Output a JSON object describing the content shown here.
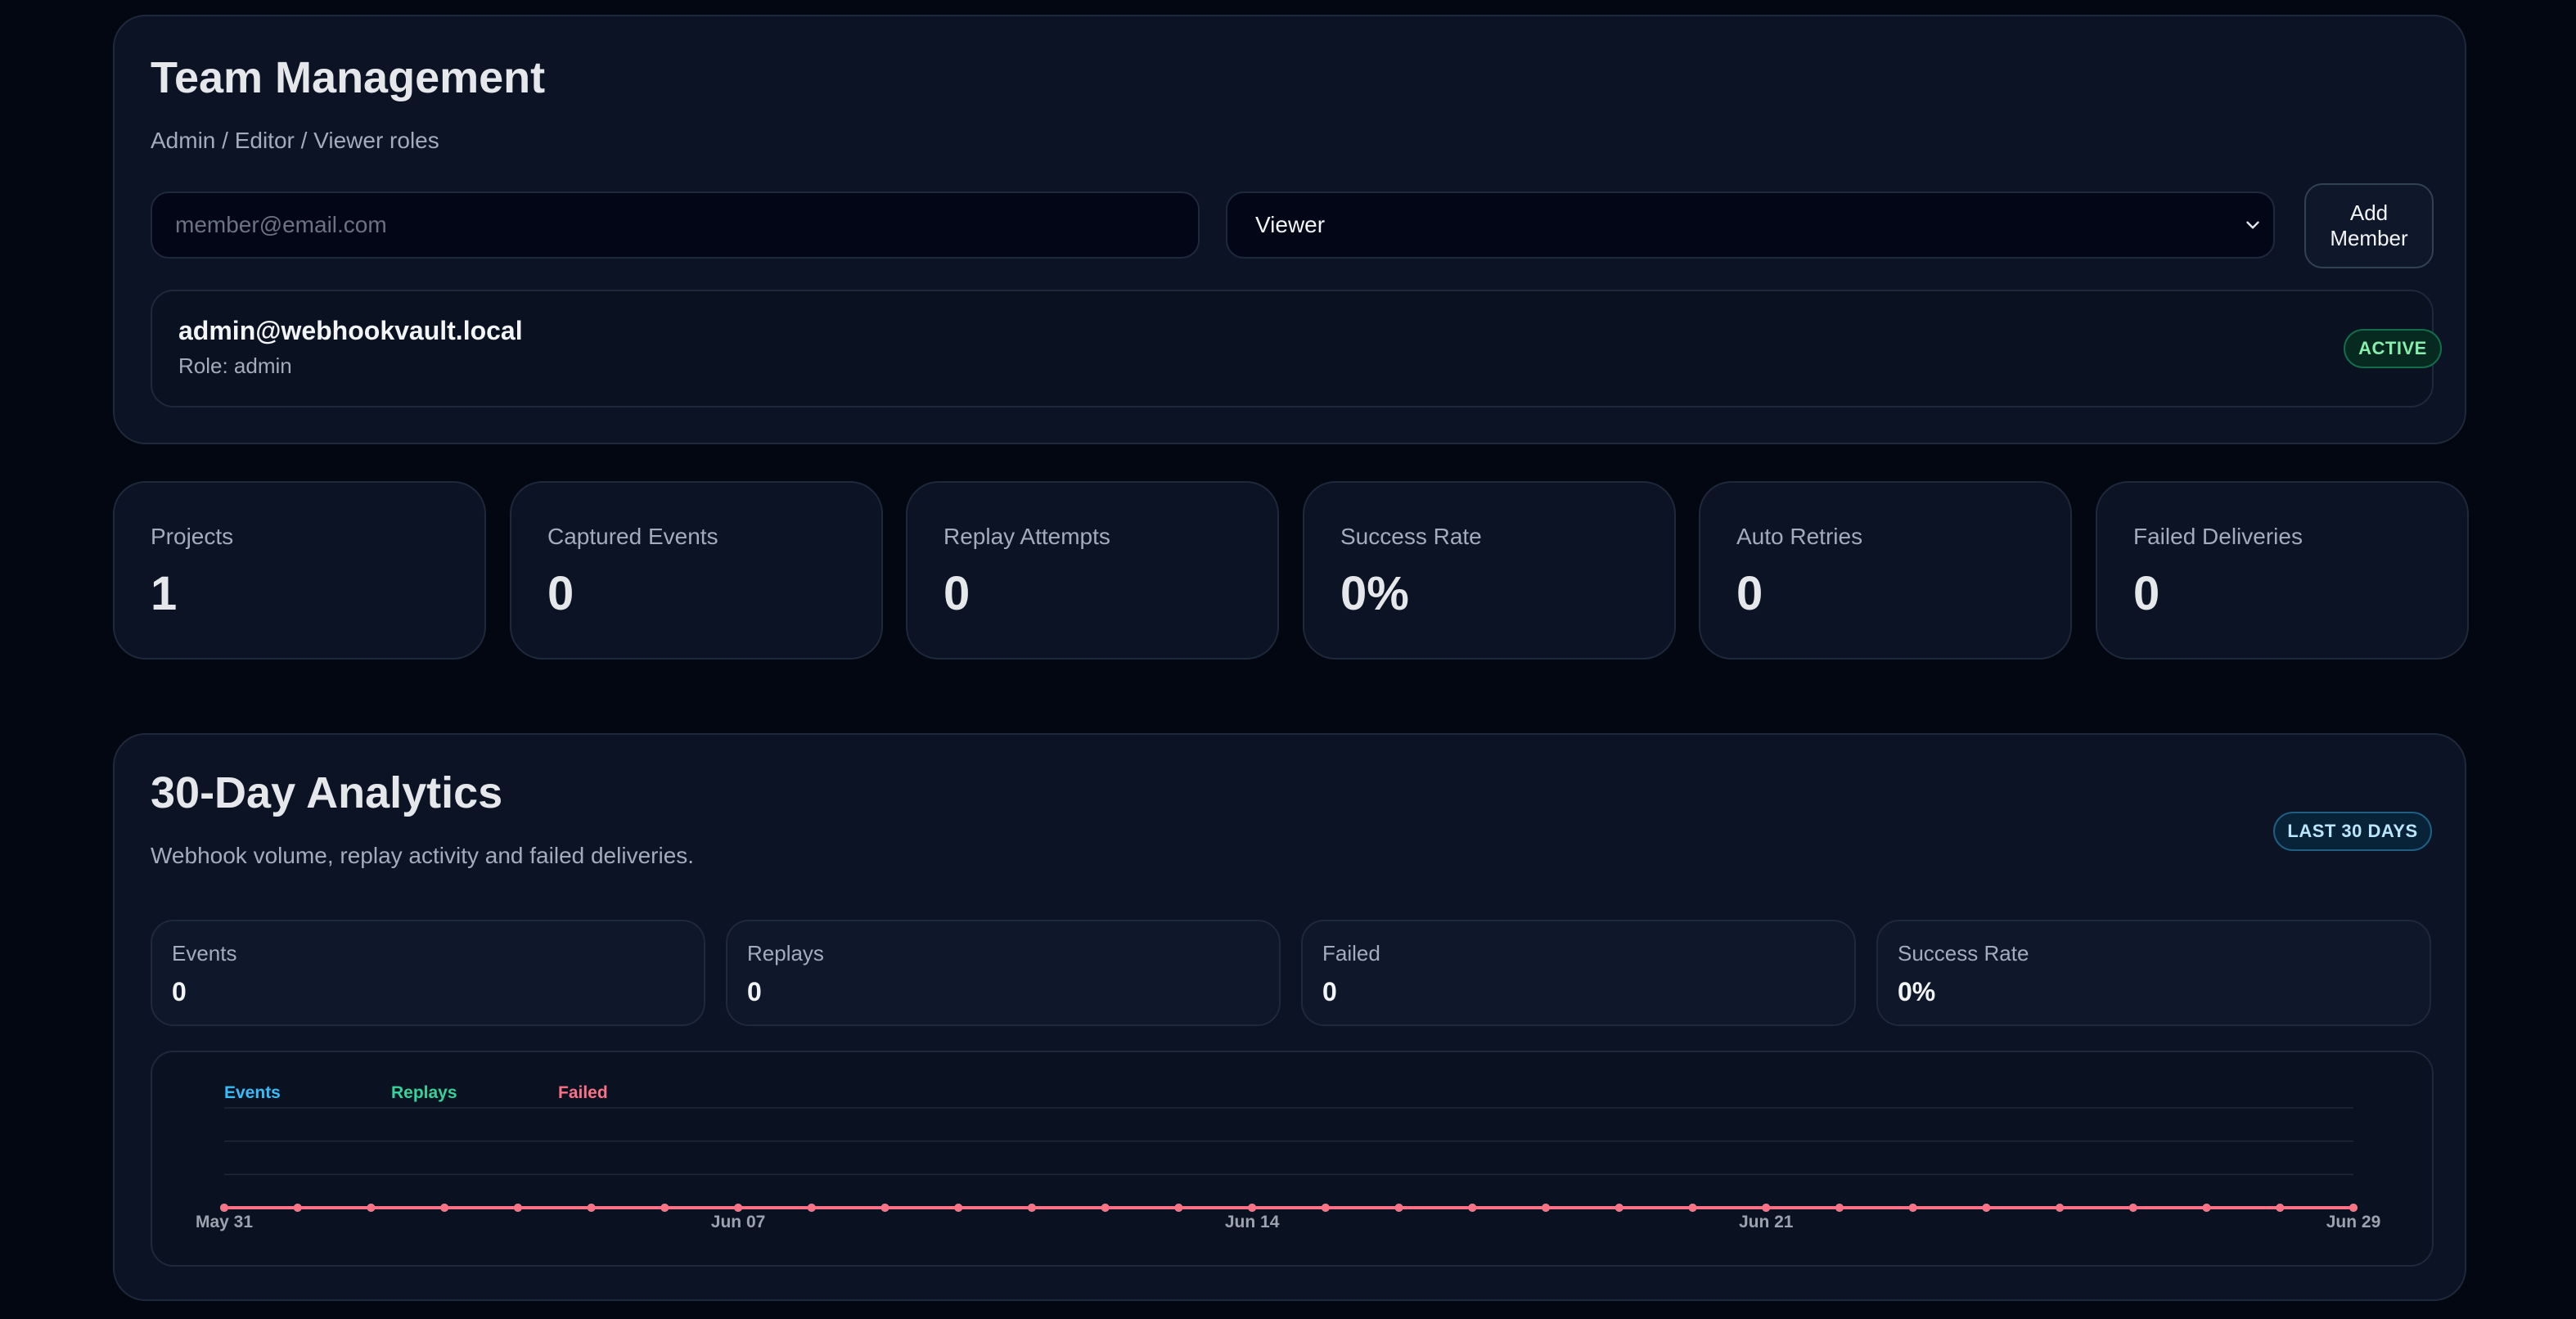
{
  "team": {
    "title": "Team Management",
    "subtitle": "Admin / Editor / Viewer roles",
    "email_placeholder": "member@email.com",
    "role_selected": "Viewer",
    "add_button": "Add Member",
    "member": {
      "email": "admin@webhookvault.local",
      "role": "Role: admin",
      "status": "ACTIVE"
    }
  },
  "stats": [
    {
      "label": "Projects",
      "value": "1"
    },
    {
      "label": "Captured Events",
      "value": "0"
    },
    {
      "label": "Replay Attempts",
      "value": "0"
    },
    {
      "label": "Success Rate",
      "value": "0%"
    },
    {
      "label": "Auto Retries",
      "value": "0"
    },
    {
      "label": "Failed Deliveries",
      "value": "0"
    }
  ],
  "analytics": {
    "title": "30-Day Analytics",
    "subtitle": "Webhook volume, replay activity and failed deliveries.",
    "range_badge": "LAST 30 DAYS",
    "summary": [
      {
        "label": "Events",
        "value": "0"
      },
      {
        "label": "Replays",
        "value": "0"
      },
      {
        "label": "Failed",
        "value": "0"
      },
      {
        "label": "Success Rate",
        "value": "0%"
      }
    ]
  },
  "colors": {
    "events": "#38bdf8",
    "replays": "#34d399",
    "failed": "#fb7185"
  },
  "chart_data": {
    "type": "line",
    "title": "",
    "x": [
      "May 31",
      "Jun 01",
      "Jun 02",
      "Jun 03",
      "Jun 04",
      "Jun 05",
      "Jun 06",
      "Jun 07",
      "Jun 08",
      "Jun 09",
      "Jun 10",
      "Jun 11",
      "Jun 12",
      "Jun 13",
      "Jun 14",
      "Jun 15",
      "Jun 16",
      "Jun 17",
      "Jun 18",
      "Jun 19",
      "Jun 20",
      "Jun 21",
      "Jun 22",
      "Jun 23",
      "Jun 24",
      "Jun 25",
      "Jun 26",
      "Jun 27",
      "Jun 28",
      "Jun 29"
    ],
    "x_tick_labels": [
      "May 31",
      "Jun 07",
      "Jun 14",
      "Jun 21",
      "Jun 29"
    ],
    "series": [
      {
        "name": "Events",
        "values": [
          0,
          0,
          0,
          0,
          0,
          0,
          0,
          0,
          0,
          0,
          0,
          0,
          0,
          0,
          0,
          0,
          0,
          0,
          0,
          0,
          0,
          0,
          0,
          0,
          0,
          0,
          0,
          0,
          0,
          0
        ]
      },
      {
        "name": "Replays",
        "values": [
          0,
          0,
          0,
          0,
          0,
          0,
          0,
          0,
          0,
          0,
          0,
          0,
          0,
          0,
          0,
          0,
          0,
          0,
          0,
          0,
          0,
          0,
          0,
          0,
          0,
          0,
          0,
          0,
          0,
          0
        ]
      },
      {
        "name": "Failed",
        "values": [
          0,
          0,
          0,
          0,
          0,
          0,
          0,
          0,
          0,
          0,
          0,
          0,
          0,
          0,
          0,
          0,
          0,
          0,
          0,
          0,
          0,
          0,
          0,
          0,
          0,
          0,
          0,
          0,
          0,
          0
        ]
      }
    ],
    "ylim": [
      0,
      1
    ],
    "grid": true,
    "legend": "top-left"
  }
}
